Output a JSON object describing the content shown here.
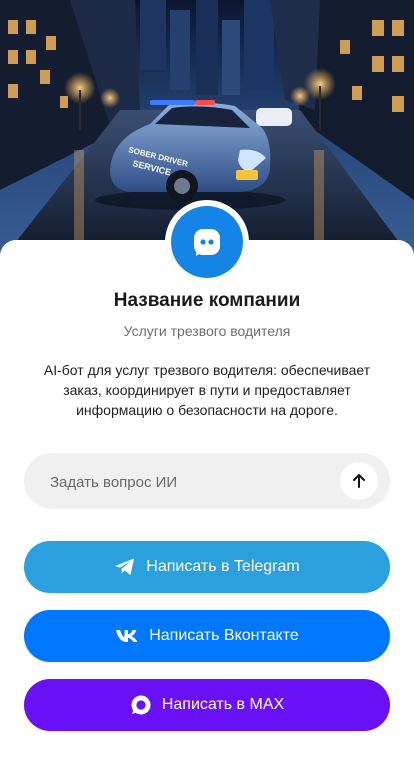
{
  "profile": {
    "avatar_icon": "chat-bubble-icon",
    "company_name": "Название компании",
    "subtitle": "Услуги трезвого водителя",
    "description": "AI-бот для услуг трезвого водителя: обеспечивает заказ, координирует в пути и предоставляет информацию о безопасности на дороге."
  },
  "ask": {
    "placeholder": "Задать вопрос ИИ",
    "value": "",
    "send_icon": "arrow-up-icon"
  },
  "buttons": {
    "telegram": {
      "label": "Написать в Telegram",
      "icon": "telegram-icon",
      "color": "#2aa0de"
    },
    "vk": {
      "label": "Написать Вконтакте",
      "icon": "vk-icon",
      "color": "#0077ff"
    },
    "max": {
      "label": "Написать в MAX",
      "icon": "max-icon",
      "color": "#6a10f6"
    }
  },
  "colors": {
    "accent": "#1584e7",
    "input_bg": "#f0f0f0"
  }
}
